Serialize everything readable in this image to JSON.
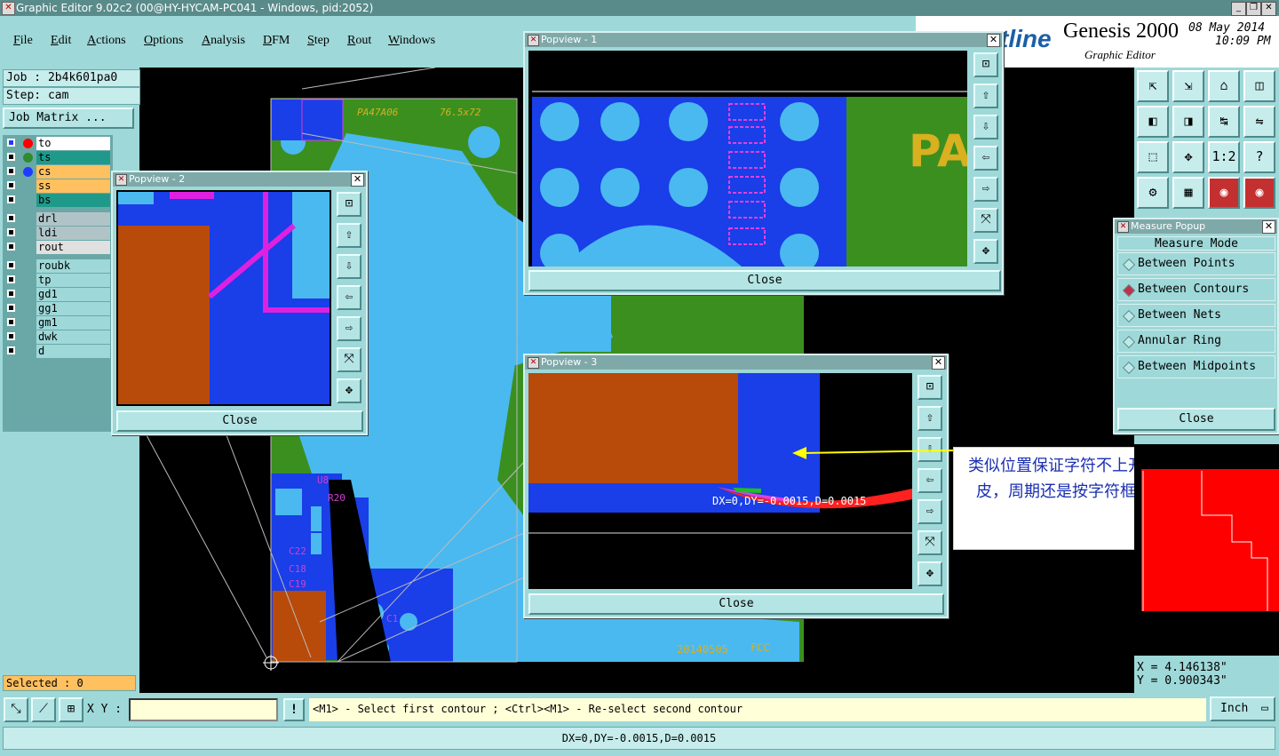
{
  "window": {
    "title": "Graphic Editor 9.02c2 (00@HY-HYCAM-PC041 - Windows, pid:2052)"
  },
  "menu": [
    "File",
    "Edit",
    "Actions",
    "Options",
    "Analysis",
    "DFM",
    "Step",
    "Rout",
    "Windows"
  ],
  "brand": {
    "logo_fragment": "tline",
    "product": "Genesis 2000",
    "subtitle": "Graphic Editor",
    "date": "08 May 2014",
    "time": "10:09 PM"
  },
  "job": {
    "job_label": "Job : 2b4k601pa0",
    "step_label": "Step: cam",
    "matrix_button": "Job Matrix ..."
  },
  "layers": [
    {
      "name": "to",
      "color": "#ff0000",
      "bg": "#ffffff",
      "active": true
    },
    {
      "name": "ts",
      "color": "#2e8b2e",
      "bg": "#1f9a8a"
    },
    {
      "name": "cs",
      "color": "#1e3cff",
      "bg": "#ffc060"
    },
    {
      "name": "ss",
      "color": "",
      "bg": "#ffc060"
    },
    {
      "name": "bs",
      "color": "",
      "bg": "#1f9a8a"
    },
    {
      "name": "drl",
      "bg": "#b0c4c8"
    },
    {
      "name": "ldi",
      "bg": "#b0c4c8"
    },
    {
      "name": "rout",
      "bg": "#e0e0e0"
    },
    {
      "name": "roubk",
      "bg": "#9fd8d8"
    },
    {
      "name": "tp",
      "bg": "#9fd8d8"
    },
    {
      "name": "gd1",
      "bg": "#9fd8d8"
    },
    {
      "name": "gg1",
      "bg": "#9fd8d8"
    },
    {
      "name": "gm1",
      "bg": "#9fd8d8"
    },
    {
      "name": "dwk",
      "bg": "#9fd8d8"
    },
    {
      "name": "d",
      "bg": "#9fd8d8"
    }
  ],
  "selected": "Selected : 0",
  "board_text": {
    "part": "PA47A06",
    "size": "76.5x72",
    "date_code": "20140505",
    "fcc": "FCC",
    "refs": [
      "U8",
      "R20",
      "C22",
      "C18",
      "C19",
      "C1"
    ]
  },
  "popviews": [
    {
      "title": "Popview - 1",
      "close": "Close",
      "overlay_text": "PA"
    },
    {
      "title": "Popview - 2",
      "close": "Close"
    },
    {
      "title": "Popview - 3",
      "close": "Close",
      "measure_text": "DX=0,DY=-0.0015,D=0.0015"
    }
  ],
  "measure_popup": {
    "title": "Measure Popup",
    "header": "Measure Mode",
    "options": [
      "Between Points",
      "Between Contours",
      "Between Nets",
      "Annular Ring",
      "Between Midpoints"
    ],
    "selected": "Between Contours",
    "close": "Close"
  },
  "annotation": "类似位置保证字符不上开窗铜皮，周期还是按字符框添加",
  "coords": {
    "x": "X = 4.146138\"",
    "y": "Y = 0.900343\""
  },
  "status": {
    "xy_label": "X Y :",
    "xy_value": "",
    "warn": "!",
    "hint": "<M1> - Select first contour ; <Ctrl><M1> - Re-select second contour",
    "units": "Inch"
  },
  "message": "DX=0,DY=-0.0015,D=0.0015",
  "toolbar_icons": [
    "zoom-home-icon",
    "zoom-previous-icon",
    "home-icon",
    "split-icon",
    "pan-left-icon",
    "pan-right-icon",
    "swap-icon",
    "snap-icon",
    "zoom-fit-icon",
    "center-icon",
    "scale-1-2-icon",
    "help-icon",
    "tools-icon",
    "grid-icon",
    "layers-a-icon",
    "layers-b-icon"
  ],
  "toolbar_glyphs": [
    "⇱",
    "⇲",
    "⌂",
    "◫",
    "◧",
    "◨",
    "↹",
    "⇋",
    "⬚",
    "✥",
    "1:2",
    "?",
    "⚙",
    "▦",
    "◉",
    "◉"
  ]
}
